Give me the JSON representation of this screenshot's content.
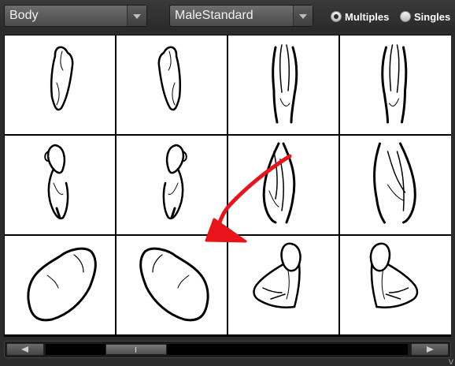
{
  "toolbar": {
    "category_dropdown": {
      "value": "Body"
    },
    "model_dropdown": {
      "value": "MaleStandard"
    },
    "view_mode": {
      "options": [
        {
          "label": "Multiples",
          "selected": true
        },
        {
          "label": "Singles",
          "selected": false
        }
      ]
    }
  },
  "grid": {
    "rows": 3,
    "columns": 4,
    "thumbnails": [
      {
        "icon": "upper-arm-side-left-icon"
      },
      {
        "icon": "upper-arm-side-right-icon"
      },
      {
        "icon": "upper-arm-front-left-icon"
      },
      {
        "icon": "upper-arm-front-right-icon"
      },
      {
        "icon": "flexed-upper-arm-left-icon"
      },
      {
        "icon": "flexed-upper-arm-right-icon"
      },
      {
        "icon": "forearm-left-icon"
      },
      {
        "icon": "forearm-right-icon"
      },
      {
        "icon": "shoulder-pad-left-icon"
      },
      {
        "icon": "shoulder-pad-right-icon"
      },
      {
        "icon": "flexed-arm-left-icon"
      },
      {
        "icon": "flexed-arm-right-icon"
      }
    ]
  },
  "annotation": {
    "color": "#e8141a"
  },
  "scrollbar": {
    "position": 0.2
  },
  "corner_text": "V"
}
